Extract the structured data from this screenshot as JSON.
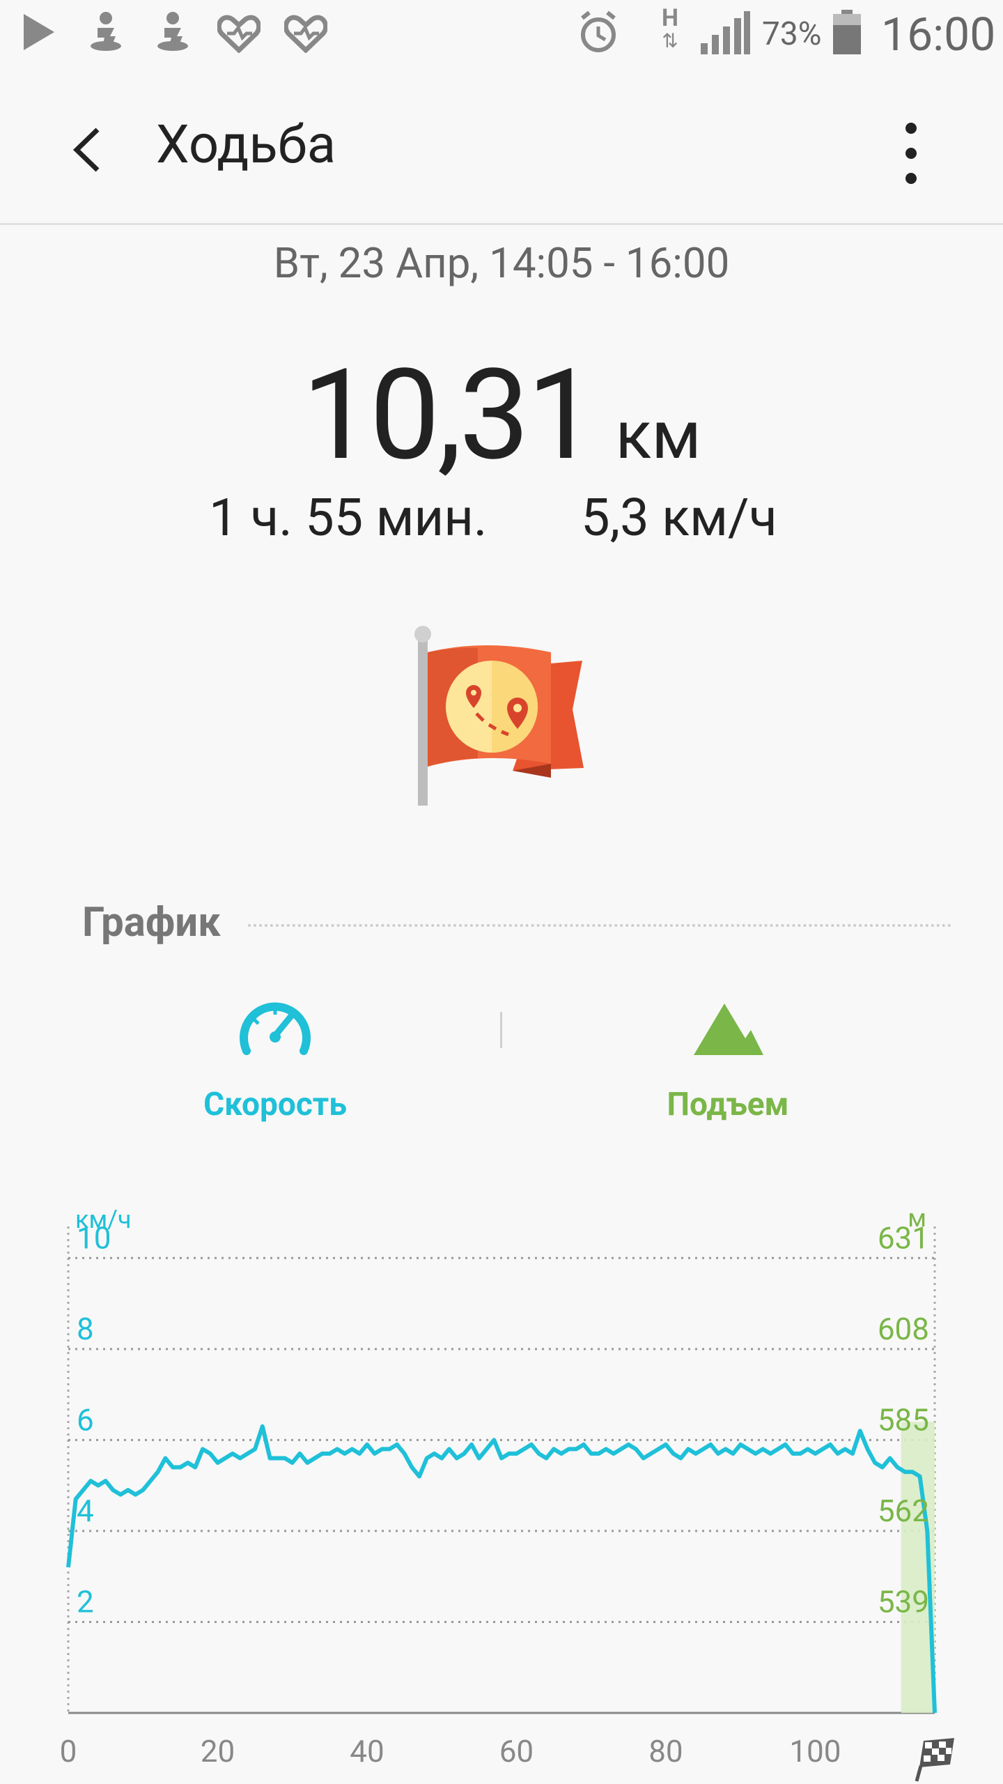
{
  "status_bar": {
    "battery": "73%",
    "time": "16:00",
    "network": "H"
  },
  "app_bar": {
    "title": "Ходьба"
  },
  "workout": {
    "date": "Вт, 23 Апр, 14:05 - 16:00",
    "distance_value": "10,31",
    "distance_unit": "км",
    "duration": "1 ч. 55 мин.",
    "avg_speed": "5,3 км/ч"
  },
  "graph_section": {
    "label": "График",
    "tabs": [
      {
        "label": "Скорость",
        "icon": "speedometer-icon",
        "color": "#1fc0d8"
      },
      {
        "label": "Подъем",
        "icon": "mountain-icon",
        "color": "#7ab648"
      }
    ]
  },
  "colors": {
    "speed": "#1fc0d8",
    "elevation": "#7ab648",
    "elevation_fill": "#d8ecc6"
  },
  "chart_data": {
    "type": "line",
    "left_unit": "км/ч",
    "right_unit": "м",
    "left_ticks": [
      2,
      4,
      6,
      8,
      10
    ],
    "right_ticks": [
      539,
      562,
      585,
      608,
      631
    ],
    "x_ticks": [
      0,
      20,
      40,
      60,
      80,
      100
    ],
    "ylim": [
      0,
      11
    ],
    "xlim": [
      0,
      116
    ],
    "series": [
      {
        "name": "Скорость",
        "x": [
          0,
          1,
          2,
          3,
          4,
          5,
          6,
          7,
          8,
          9,
          10,
          11,
          12,
          13,
          14,
          15,
          16,
          17,
          18,
          19,
          20,
          21,
          22,
          23,
          24,
          25,
          26,
          27,
          28,
          29,
          30,
          31,
          32,
          33,
          34,
          35,
          36,
          37,
          38,
          39,
          40,
          41,
          42,
          43,
          44,
          45,
          46,
          47,
          48,
          49,
          50,
          51,
          52,
          53,
          54,
          55,
          56,
          57,
          58,
          59,
          60,
          61,
          62,
          63,
          64,
          65,
          66,
          67,
          68,
          69,
          70,
          71,
          72,
          73,
          74,
          75,
          76,
          77,
          78,
          79,
          80,
          81,
          82,
          83,
          84,
          85,
          86,
          87,
          88,
          89,
          90,
          91,
          92,
          93,
          94,
          95,
          96,
          97,
          98,
          99,
          100,
          101,
          102,
          103,
          104,
          105,
          106,
          107,
          108,
          109,
          110,
          111,
          112,
          113,
          114,
          115,
          116
        ],
        "values": [
          3.2,
          4.7,
          4.9,
          5.1,
          5.0,
          5.1,
          4.9,
          4.8,
          4.9,
          4.8,
          4.9,
          5.1,
          5.3,
          5.6,
          5.4,
          5.4,
          5.5,
          5.4,
          5.8,
          5.7,
          5.5,
          5.6,
          5.7,
          5.6,
          5.7,
          5.8,
          6.3,
          5.6,
          5.6,
          5.6,
          5.5,
          5.7,
          5.5,
          5.6,
          5.7,
          5.7,
          5.8,
          5.7,
          5.8,
          5.7,
          5.9,
          5.7,
          5.8,
          5.8,
          5.9,
          5.7,
          5.4,
          5.2,
          5.6,
          5.7,
          5.6,
          5.8,
          5.6,
          5.7,
          5.9,
          5.6,
          5.8,
          6.0,
          5.6,
          5.7,
          5.7,
          5.8,
          5.9,
          5.7,
          5.6,
          5.8,
          5.7,
          5.8,
          5.8,
          5.9,
          5.7,
          5.7,
          5.8,
          5.7,
          5.8,
          5.9,
          5.8,
          5.6,
          5.7,
          5.8,
          5.9,
          5.7,
          5.6,
          5.8,
          5.7,
          5.8,
          5.9,
          5.7,
          5.8,
          5.7,
          5.9,
          5.8,
          5.7,
          5.8,
          5.7,
          5.8,
          5.9,
          5.7,
          5.7,
          5.8,
          5.7,
          5.8,
          5.9,
          5.7,
          5.8,
          5.7,
          6.2,
          5.8,
          5.5,
          5.4,
          5.6,
          5.4,
          5.3,
          5.3,
          5.2,
          4.0,
          0.0
        ]
      }
    ],
    "highlight_x_range": [
      111.5,
      116
    ]
  }
}
